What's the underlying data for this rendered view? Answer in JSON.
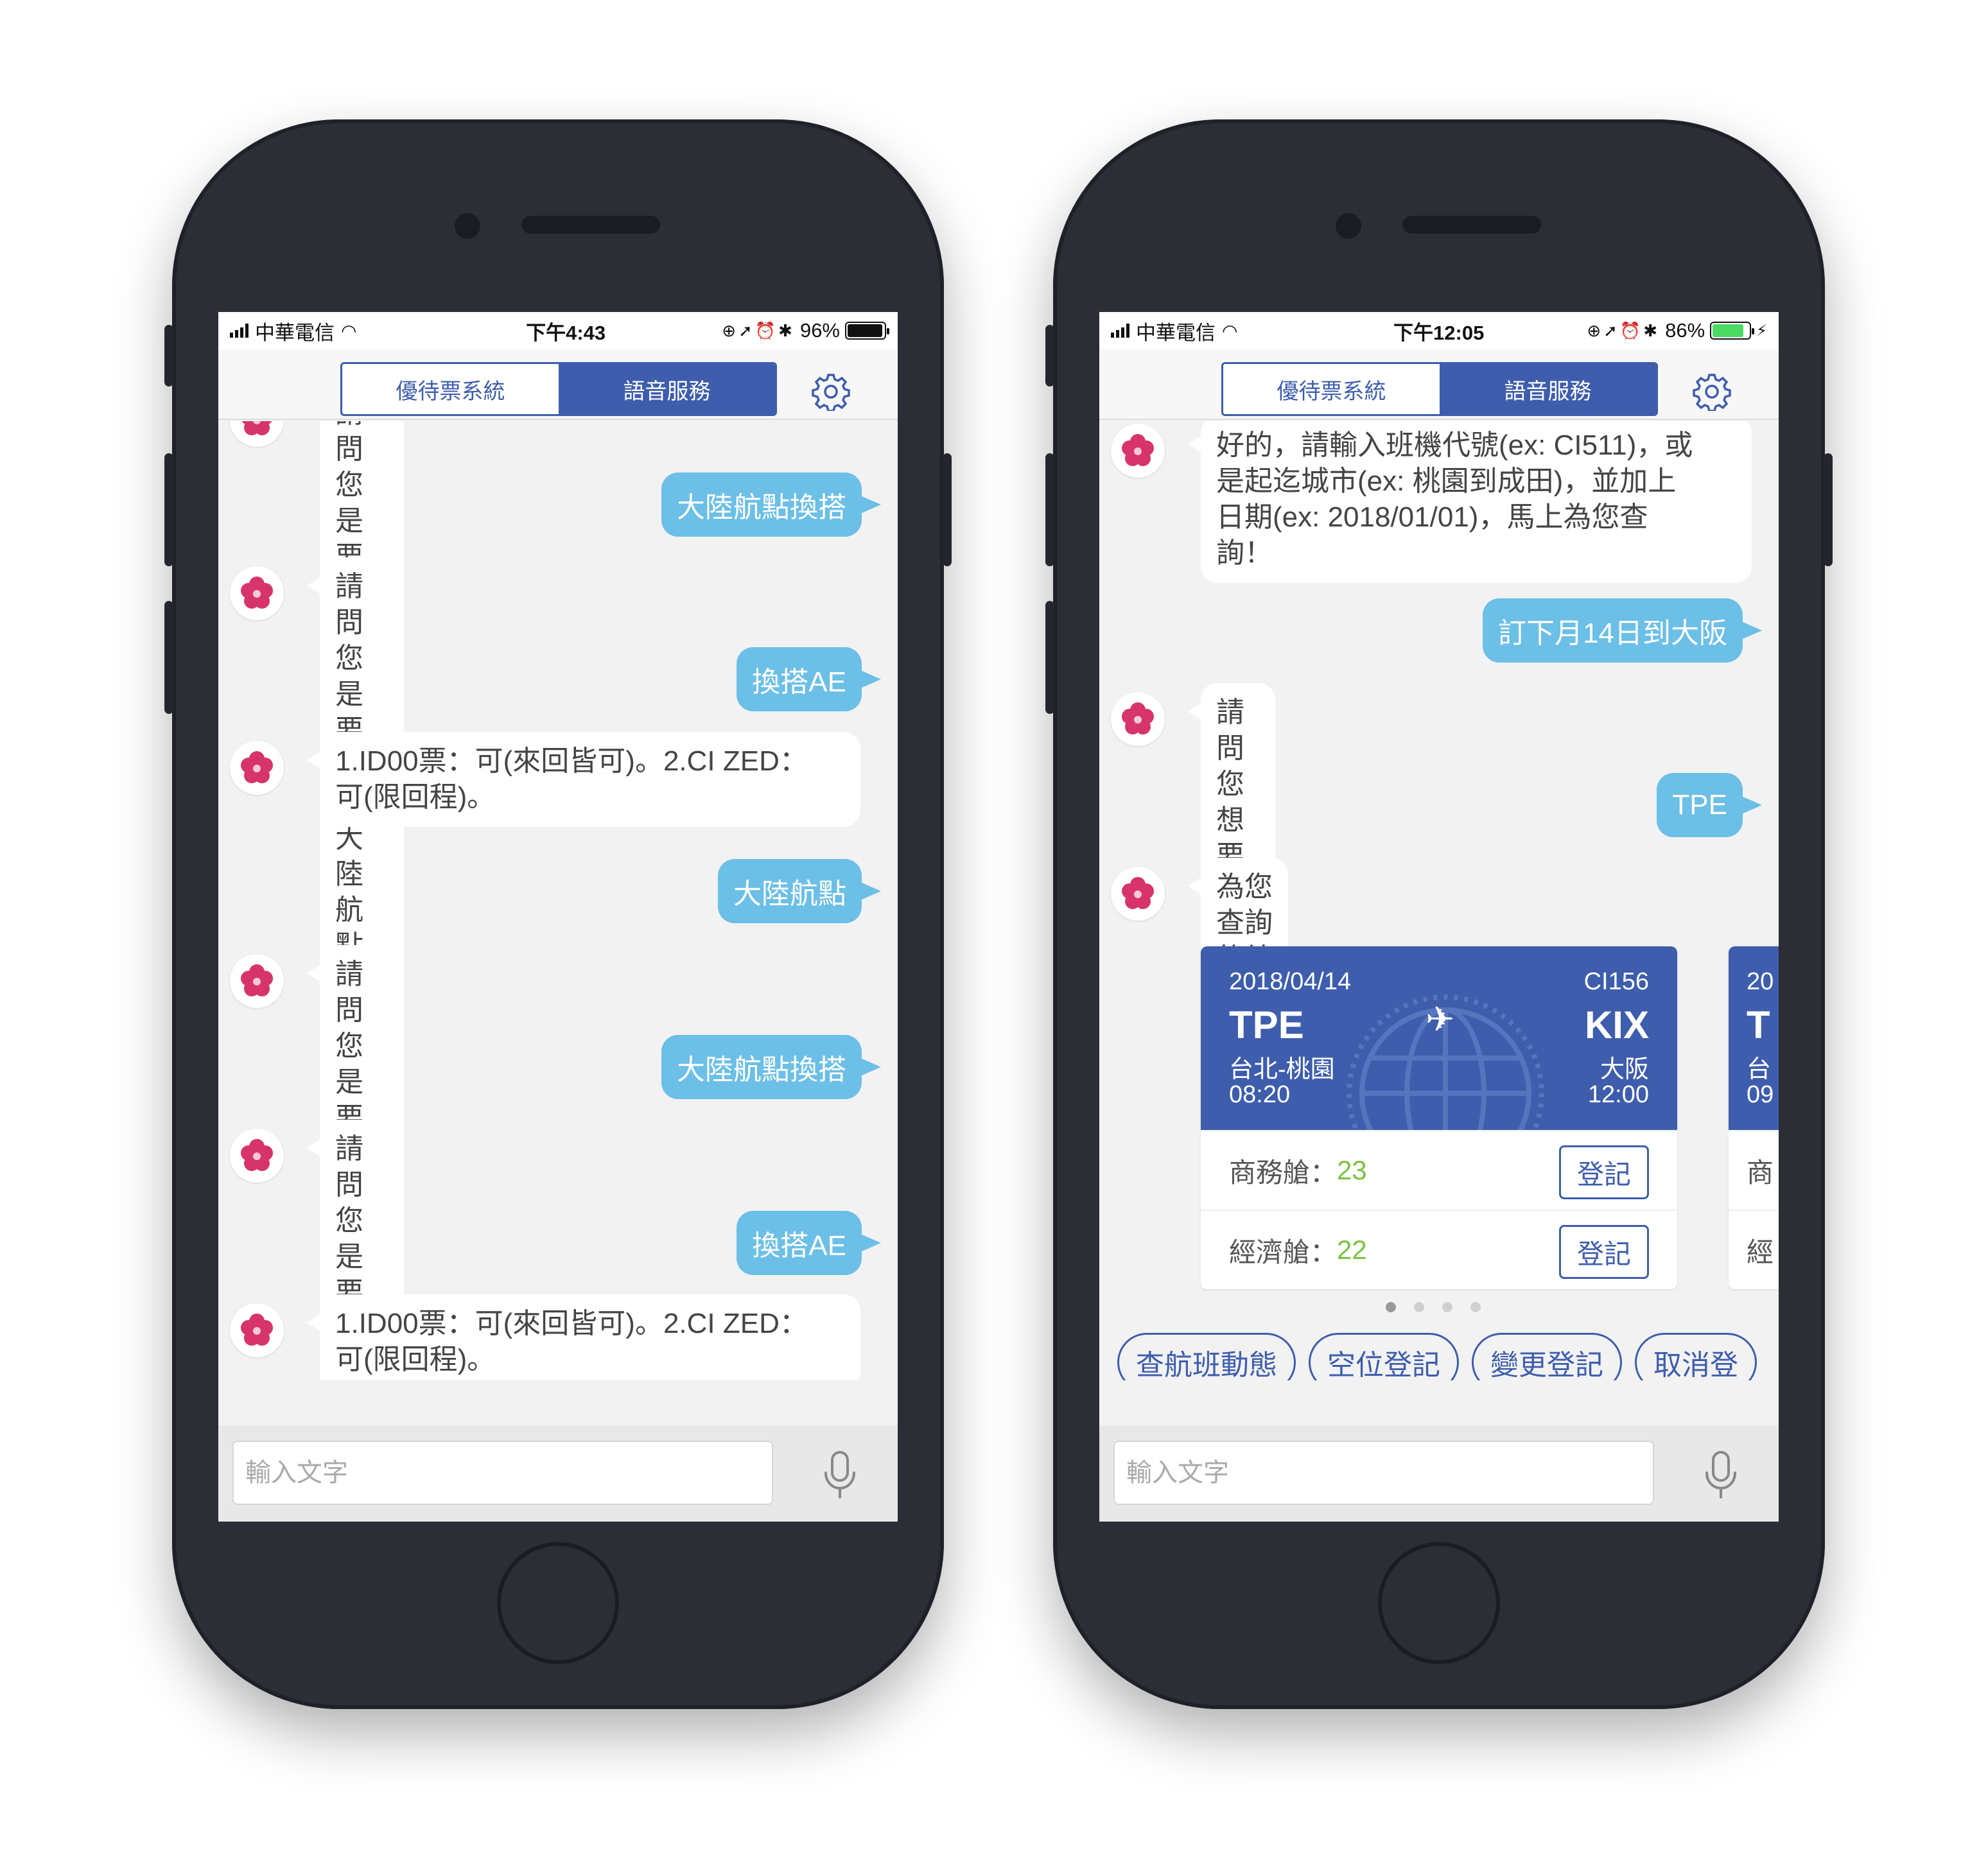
{
  "left_phone": {
    "status": {
      "carrier": "中華電信",
      "time": "下午4:43",
      "battery": "96%",
      "battery_level": 0.96
    },
    "tabs": [
      {
        "label": "優待票系統",
        "active": false
      },
      {
        "label": "語音服務",
        "active": true
      }
    ],
    "messages": [
      {
        "from": "bot",
        "text": "請問您是要換搭大陸航點還是AE?"
      },
      {
        "from": "user",
        "text": "大陸航點換搭"
      },
      {
        "from": "bot",
        "text": "請問您是要換搭大陸航點還是AE?"
      },
      {
        "from": "user",
        "text": "換搭AE"
      },
      {
        "from": "bot",
        "text": "1.ID00票：可(來回皆可)。2.CI ZED：",
        "text2": "可(限回程)。"
      },
      {
        "from": "user",
        "text": "大陸航點"
      },
      {
        "from": "bot",
        "text": "請問您是要換搭大陸航點還是AE?"
      },
      {
        "from": "user",
        "text": "大陸航點換搭"
      },
      {
        "from": "bot",
        "text": "請問您是要換搭大陸航點還是AE?"
      },
      {
        "from": "user",
        "text": "換搭AE"
      },
      {
        "from": "bot",
        "text": "1.ID00票：可(來回皆可)。2.CI ZED：",
        "text2": "可(限回程)。"
      }
    ],
    "input_placeholder": "輸入文字"
  },
  "right_phone": {
    "status": {
      "carrier": "中華電信",
      "time": "下午12:05",
      "battery": "86%",
      "battery_level": 0.86,
      "battery_color": "#4cd964"
    },
    "tabs": [
      {
        "label": "優待票系統",
        "active": false
      },
      {
        "label": "語音服務",
        "active": true
      }
    ],
    "messages": [
      {
        "from": "bot",
        "lines": [
          "好的，請輸入班機代號(ex: CI511)，或",
          "是起迄城市(ex: 桃園到成田)，並加上",
          "日期(ex: 2018/01/01)，馬上為您查",
          "詢！"
        ]
      },
      {
        "from": "user",
        "text": "訂下月14日到大阪"
      },
      {
        "from": "bot",
        "text": "請問您想要從哪裡出發呢?"
      },
      {
        "from": "user",
        "text": "TPE"
      },
      {
        "from": "bot",
        "text": "為您查詢的結果如下："
      }
    ],
    "flight_cards": [
      {
        "date": "2018/04/14",
        "flight": "CI156",
        "from_code": "TPE",
        "from_city": "台北-桃園",
        "depart": "08:20",
        "to_code": "KIX",
        "to_city": "大阪",
        "arrive": "12:00",
        "business_label": "商務艙：",
        "business_count": "23",
        "economy_label": "經濟艙：",
        "economy_count": "22",
        "button": "登記"
      },
      {
        "date": "20",
        "from_code": "T",
        "from_city": "台",
        "depart": "09",
        "business_label": "商",
        "economy_label": "經"
      }
    ],
    "pager": {
      "pages": 4,
      "active": 1
    },
    "quick_replies": [
      "查航班動態",
      "空位登記",
      "變更登記",
      "取消登"
    ],
    "input_placeholder": "輸入文字"
  },
  "colors": {
    "brand": "#3e5dac",
    "user_bubble": "#6cbfe6",
    "seat_count": "#7cc242"
  }
}
